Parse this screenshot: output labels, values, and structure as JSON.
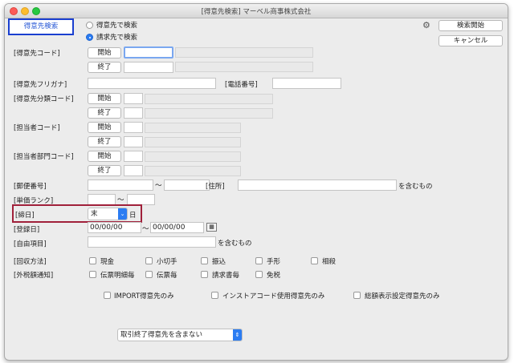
{
  "window": {
    "title": "[得意先検索] マーベル商事株式会社"
  },
  "tab": {
    "label": "得意先検索"
  },
  "search_mode": {
    "option_customer": "得意先で検索",
    "option_billing": "請求先で検索"
  },
  "buttons": {
    "search": "検索開始",
    "cancel": "キャンセル"
  },
  "labels": {
    "customer_code": "[得意先コード]",
    "customer_kana": "[得意先フリガナ]",
    "phone": "[電話番号]",
    "category_code": "[得意先分類コード]",
    "staff_code": "[担当者コード]",
    "dept_code": "[担当者部門コード]",
    "postal": "[郵便番号]",
    "address": "[住所]",
    "contains1": "を含むもの",
    "price_rank": "[単価ランク]",
    "closing_day": "[締日]",
    "day_suffix": "日",
    "reg_date": "[登録日]",
    "free_item": "[自由項目]",
    "contains2": "を含むもの",
    "collection": "[回収方法]",
    "tax_notice": "[外税額通知]",
    "tilde": "〜"
  },
  "range": {
    "start": "開始",
    "end": "終了"
  },
  "closing_value": "末",
  "reg_date_from": "00/00/00",
  "reg_date_to": "00/00/00",
  "collection_options": [
    "現金",
    "小切手",
    "振込",
    "手形",
    "相殺"
  ],
  "tax_options": [
    "伝票明細毎",
    "伝票毎",
    "請求書毎",
    "免税"
  ],
  "extra_filters": [
    "IMPORT得意先のみ",
    "インストアコード使用得意先のみ",
    "総額表示設定得意先のみ"
  ],
  "closed_select": "取引終了得意先を含まない",
  "colors": {
    "tab_border": "#1a3fd0",
    "closing_highlight": "#a0203a",
    "accent": "#2b7cf2"
  }
}
